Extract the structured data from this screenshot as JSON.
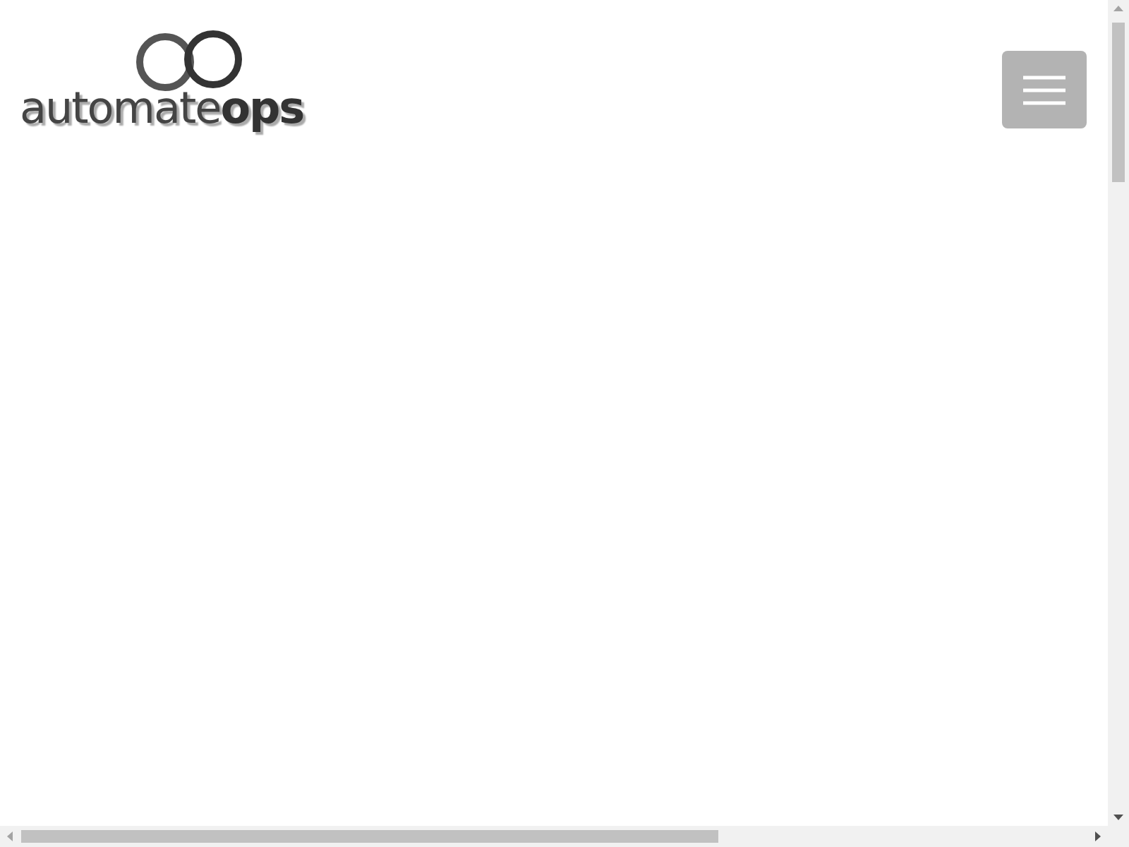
{
  "header": {
    "logo": {
      "text": "automate**ops**"
    },
    "menu_button": {
      "kind": "hamburger"
    }
  }
}
